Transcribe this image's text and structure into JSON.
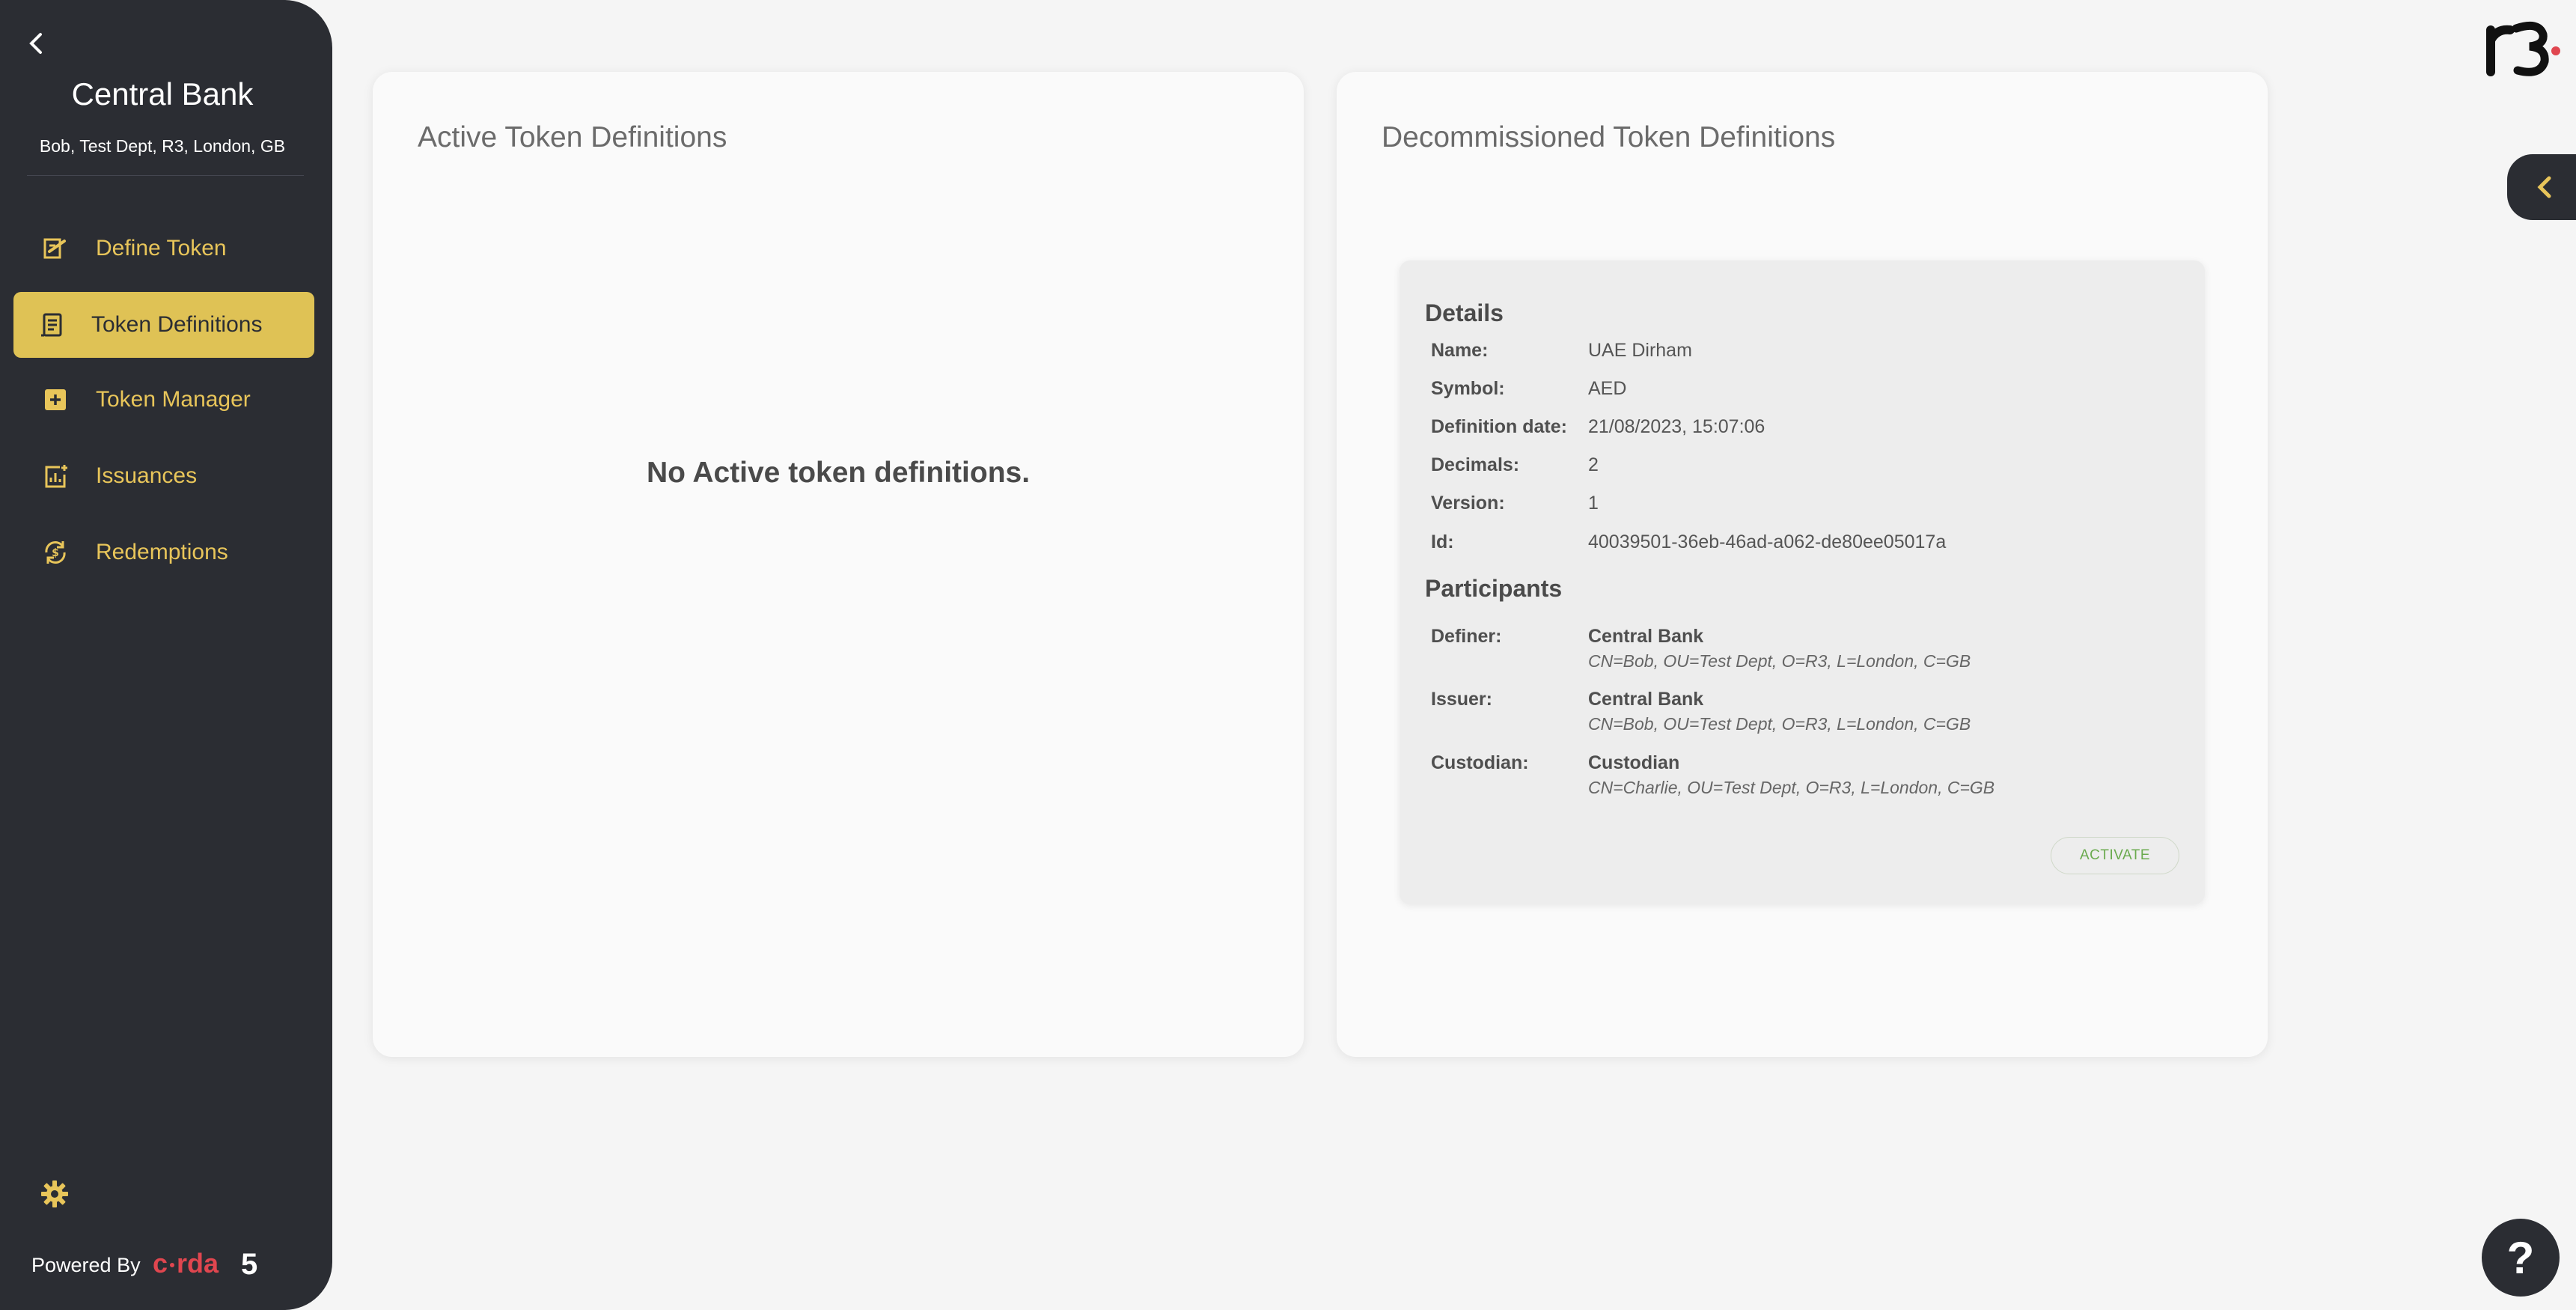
{
  "sidebar": {
    "org_name": "Central Bank",
    "org_x500": "Bob, Test Dept, R3, London, GB",
    "items": [
      {
        "label": "Define Token",
        "icon": "define-token-icon"
      },
      {
        "label": "Token Definitions",
        "icon": "token-definitions-icon",
        "active": true
      },
      {
        "label": "Token Manager",
        "icon": "plus-box-icon"
      },
      {
        "label": "Issuances",
        "icon": "issuances-icon"
      },
      {
        "label": "Redemptions",
        "icon": "redemptions-icon"
      }
    ],
    "powered_by": "Powered By",
    "corda_logo_text": "corda5"
  },
  "active_panel": {
    "title": "Active Token Definitions",
    "empty_message": "No Active token definitions."
  },
  "decommissioned_panel": {
    "title": "Decommissioned Token Definitions",
    "token": {
      "details_title": "Details",
      "details": [
        {
          "key": "Name:",
          "value": "UAE Dirham"
        },
        {
          "key": "Symbol:",
          "value": "AED"
        },
        {
          "key": "Definition date:",
          "value": "21/08/2023, 15:07:06"
        },
        {
          "key": "Decimals:",
          "value": "2"
        },
        {
          "key": "Version:",
          "value": "1"
        },
        {
          "key": "Id:",
          "value": "40039501-36eb-46ad-a062-de80ee05017a"
        }
      ],
      "participants_title": "Participants",
      "participants": [
        {
          "key": "Definer:",
          "name": "Central Bank",
          "x500": "CN=Bob, OU=Test Dept, O=R3, L=London, C=GB"
        },
        {
          "key": "Issuer:",
          "name": "Central Bank",
          "x500": "CN=Bob, OU=Test Dept, O=R3, L=London, C=GB"
        },
        {
          "key": "Custodian:",
          "name": "Custodian",
          "x500": "CN=Charlie, OU=Test Dept, O=R3, L=London, C=GB"
        }
      ],
      "activate_label": "ACTIVATE"
    }
  },
  "help_label": "?",
  "colors": {
    "sidebar_bg": "#2b2d33",
    "accent_gold": "#dfc255",
    "nav_text": "#e8c55a",
    "corda_red": "#e0464f",
    "activate_green": "#6aaa4e"
  }
}
